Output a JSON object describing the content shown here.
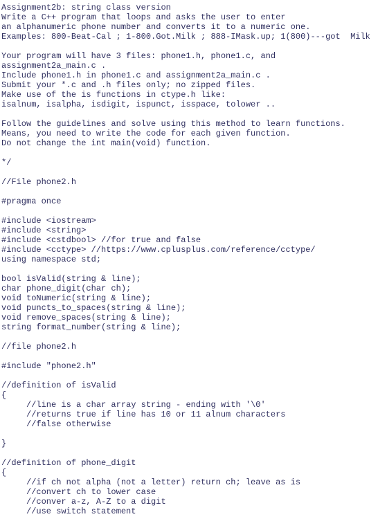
{
  "lines": [
    "Assignment2b: string class version",
    "Write a C++ program that loops and asks the user to enter",
    "an alphanumeric phone number and converts it to a numeric one.",
    "Examples: 800-Beat-Cal ; 1-800.Got.Milk ; 888-IMask.up; 1(800)---got  Milk",
    "",
    "Your program will have 3 files: phone1.h, phone1.c, and",
    "assignment2a_main.c .",
    "Include phone1.h in phone1.c and assignment2a_main.c .",
    "Submit your *.c and .h files only; no zipped files.",
    "Make use of the is functions in ctype.h like:",
    "isalnum, isalpha, isdigit, ispunct, isspace, tolower ..",
    "",
    "Follow the guidelines and solve using this method to learn functions.",
    "Means, you need to write the code for each given function.",
    "Do not change the int main(void) function.",
    "",
    "*/",
    "",
    "//File phone2.h",
    "",
    "#pragma once",
    "",
    "#include <iostream>",
    "#include <string>",
    "#include <cstdbool> //for true and false",
    "#include <cctype> //https://www.cplusplus.com/reference/cctype/",
    "using namespace std;",
    "",
    "bool isValid(string & line);",
    "char phone_digit(char ch);",
    "void toNumeric(string & line);",
    "void puncts_to_spaces(string & line);",
    "void remove_spaces(string & line);",
    "string format_number(string & line);",
    "",
    "//file phone2.h",
    "",
    "#include \"phone2.h\"",
    "",
    "//definition of isValid",
    "{",
    "     //line is a char array string - ending with '\\0'",
    "     //returns true if line has 10 or 11 alnum characters",
    "     //false otherwise",
    "",
    "}",
    "",
    "//definition of phone_digit",
    "{",
    "     //if ch not alpha (not a letter) return ch; leave as is",
    "     //convert ch to lower case",
    "     //conver a-z, A-Z to a digit",
    "     //use switch statement"
  ]
}
